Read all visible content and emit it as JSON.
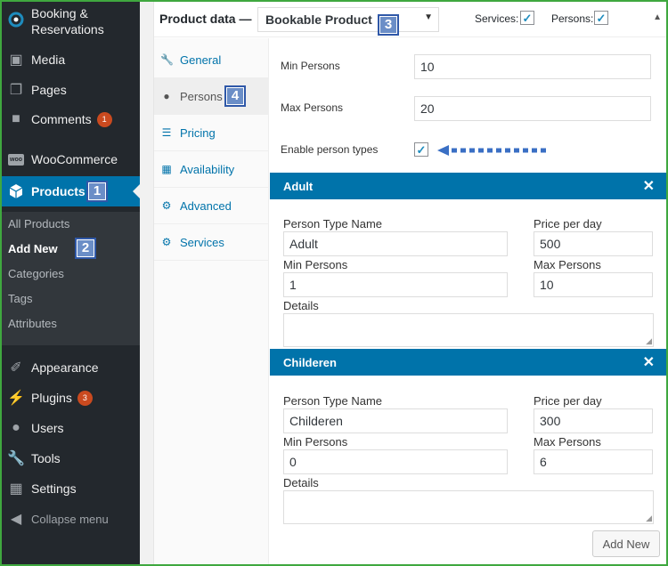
{
  "sidebar": {
    "items": [
      {
        "label": "Booking &",
        "label2": "Reservations",
        "icon": "booking-icon"
      },
      {
        "label": "Media",
        "icon": "media-icon"
      },
      {
        "label": "Pages",
        "icon": "pages-icon"
      },
      {
        "label": "Comments",
        "icon": "comments-icon",
        "badge": "1"
      },
      {
        "label": "WooCommerce",
        "icon": "woocommerce-icon",
        "icon_text": "woo"
      },
      {
        "label": "Products",
        "icon": "products-icon"
      },
      {
        "label": "Appearance",
        "icon": "appearance-icon"
      },
      {
        "label": "Plugins",
        "icon": "plugins-icon",
        "badge": "3"
      },
      {
        "label": "Users",
        "icon": "users-icon"
      },
      {
        "label": "Tools",
        "icon": "tools-icon"
      },
      {
        "label": "Settings",
        "icon": "settings-icon"
      },
      {
        "label": "Collapse menu",
        "icon": "collapse-icon"
      }
    ],
    "submenu": [
      "All Products",
      "Add New",
      "Categories",
      "Tags",
      "Attributes"
    ]
  },
  "markers": [
    "1",
    "2",
    "3",
    "4"
  ],
  "product_data": {
    "label": "Product data —",
    "type": "Bookable Product",
    "services_label": "Services:",
    "persons_label": "Persons:"
  },
  "tabs": [
    "General",
    "Persons",
    "Pricing",
    "Availability",
    "Advanced",
    "Services"
  ],
  "persons": {
    "min_label": "Min Persons",
    "min_value": "10",
    "max_label": "Max Persons",
    "max_value": "20",
    "enable_label": "Enable person types"
  },
  "person_types": [
    {
      "title": "Adult",
      "name_label": "Person Type Name",
      "name": "Adult",
      "price_label": "Price per day",
      "price": "500",
      "min_label": "Min Persons",
      "min": "1",
      "max_label": "Max Persons",
      "max": "10",
      "details_label": "Details"
    },
    {
      "title": "Childeren",
      "name_label": "Person Type Name",
      "name": "Childeren",
      "price_label": "Price per day",
      "price": "300",
      "min_label": "Min Persons",
      "min": "0",
      "max_label": "Max Persons",
      "max": "6",
      "details_label": "Details"
    }
  ],
  "add_new_label": "Add New",
  "colors": {
    "accent": "#0073aa",
    "sidebar": "#23282d",
    "badge": "#ca4a1f",
    "marker": "#6b8ec7"
  }
}
